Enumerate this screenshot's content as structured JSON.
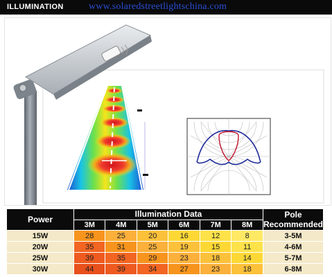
{
  "header": {
    "title": "ILLUMINATION",
    "url": "www.solaredstreetlightschina.com"
  },
  "colors": {
    "header_bg": "#0a0a0a",
    "url_color": "#2a4fd6",
    "pole_gray": "#8a9097",
    "cell_light": "#f4e9c8",
    "heat": [
      "#fdd835",
      "#fbb03b",
      "#f7941d",
      "#f26522",
      "#e8501c"
    ]
  },
  "table": {
    "power_header": "Power",
    "illum_header": "Illumination Data",
    "pole_header_line1": "Pole",
    "pole_header_line2": "Recommended",
    "distances": [
      "3M",
      "4M",
      "5M",
      "6M",
      "7M",
      "8M"
    ],
    "rows": [
      {
        "power": "15W",
        "values": [
          "28",
          "25",
          "20",
          "16",
          "12",
          "8"
        ],
        "pole": "3-5M"
      },
      {
        "power": "20W",
        "values": [
          "35",
          "31",
          "25",
          "19",
          "15",
          "11"
        ],
        "pole": "4-6M"
      },
      {
        "power": "25W",
        "values": [
          "39",
          "35",
          "29",
          "23",
          "18",
          "14"
        ],
        "pole": "5-7M"
      },
      {
        "power": "30W",
        "values": [
          "44",
          "39",
          "34",
          "27",
          "23",
          "18"
        ],
        "pole": "6-8M"
      }
    ]
  }
}
